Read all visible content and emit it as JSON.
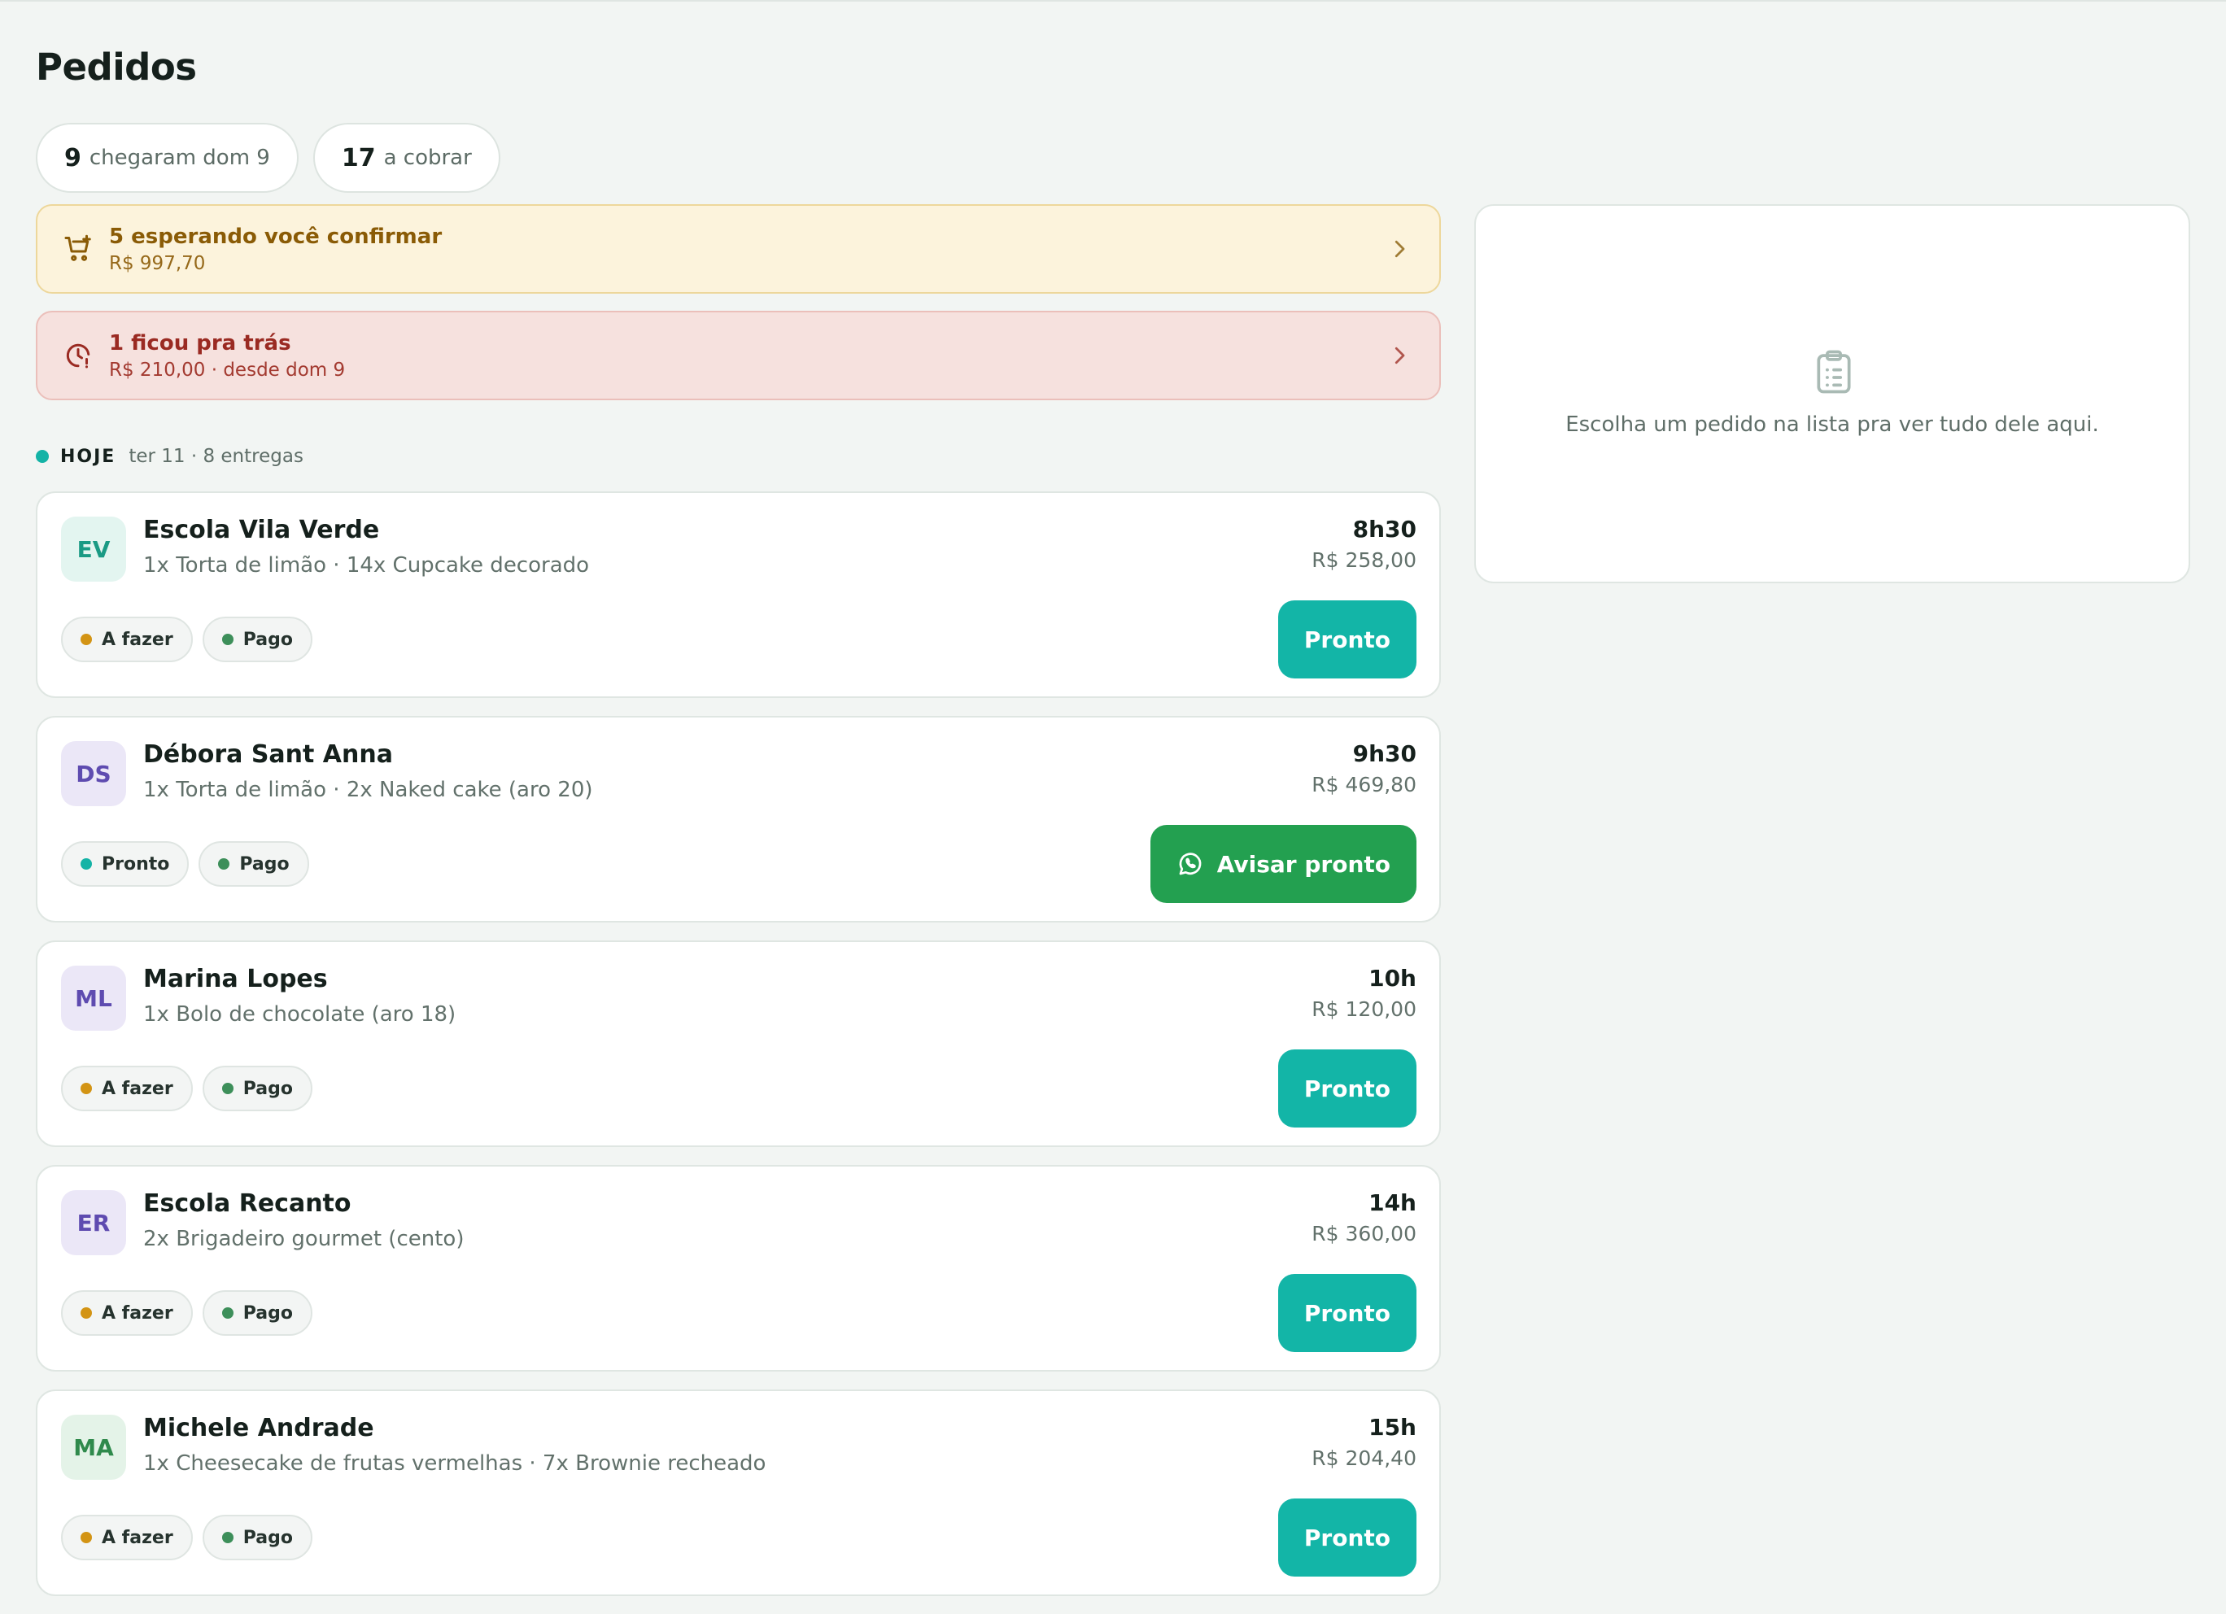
{
  "page": {
    "title": "Pedidos"
  },
  "summary_chips": [
    {
      "count": "9",
      "label": "chegaram dom 9"
    },
    {
      "count": "17",
      "label": "a cobrar"
    }
  ],
  "alerts": {
    "awaiting": {
      "title": "5 esperando você confirmar",
      "subtitle": "R$ 997,70",
      "icon": "cart-plus-icon",
      "color": "#8a5b06"
    },
    "overdue": {
      "title": "1 ficou pra trás",
      "subtitle": "R$ 210,00 · desde dom 9",
      "icon": "clock-alert-icon",
      "color": "#9a2a22"
    }
  },
  "section": {
    "label": "HOJE",
    "meta": "ter 11 · 8 entregas"
  },
  "orders": [
    {
      "initials": "EV",
      "name": "Escola Vila Verde",
      "items": "1x Torta de limão · 14x Cupcake decorado",
      "time": "8h30",
      "price": "R$ 258,00",
      "status": "A fazer",
      "payment": "Pago",
      "action": "Pronto",
      "avatar_bg": "#e3f5f0",
      "avatar_fg": "#1a9a84"
    },
    {
      "initials": "DS",
      "name": "Débora Sant Anna",
      "items": "1x Torta de limão · 2x Naked cake (aro 20)",
      "time": "9h30",
      "price": "R$ 469,80",
      "status": "Pronto",
      "payment": "Pago",
      "action": "Avisar pronto",
      "avatar_bg": "#ebe7f7",
      "avatar_fg": "#5e4bb0"
    },
    {
      "initials": "ML",
      "name": "Marina Lopes",
      "items": "1x Bolo de chocolate (aro 18)",
      "time": "10h",
      "price": "R$ 120,00",
      "status": "A fazer",
      "payment": "Pago",
      "action": "Pronto",
      "avatar_bg": "#ebe7f7",
      "avatar_fg": "#5e4bb0"
    },
    {
      "initials": "ER",
      "name": "Escola Recanto",
      "items": "2x Brigadeiro gourmet (cento)",
      "time": "14h",
      "price": "R$ 360,00",
      "status": "A fazer",
      "payment": "Pago",
      "action": "Pronto",
      "avatar_bg": "#ebe7f7",
      "avatar_fg": "#5e4bb0"
    },
    {
      "initials": "MA",
      "name": "Michele Andrade",
      "items": "1x Cheesecake de frutas vermelhas · 7x Brownie recheado",
      "time": "15h",
      "price": "R$ 204,40",
      "status": "A fazer",
      "payment": "Pago",
      "action": "Pronto",
      "avatar_bg": "#e4f3e8",
      "avatar_fg": "#2f8a4c"
    }
  ],
  "status_colors": {
    "A fazer": "#d39414",
    "Pronto": "#14b3a6",
    "Pago": "#3d8f5a"
  },
  "colors": {
    "accent": "#13b5a7",
    "whatsapp_green": "#23a050"
  },
  "detail": {
    "empty_text": "Escolha um pedido na lista pra ver tudo dele aqui.",
    "icon": "clipboard-list-icon"
  }
}
